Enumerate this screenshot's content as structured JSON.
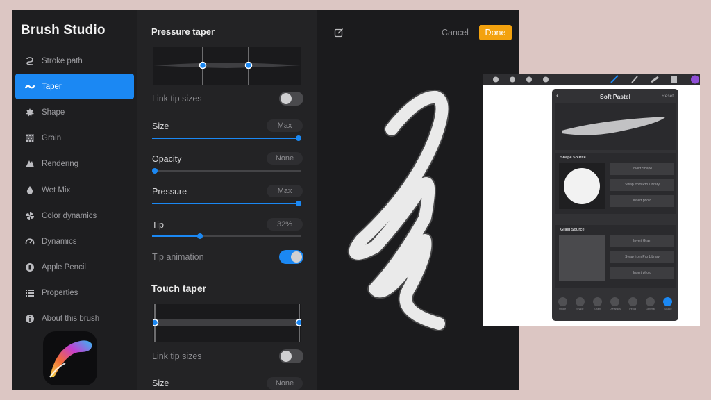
{
  "studio": {
    "title": "Brush Studio",
    "nav": [
      {
        "label": "Stroke path",
        "icon": "stroke-path-icon"
      },
      {
        "label": "Taper",
        "icon": "taper-icon",
        "active": true
      },
      {
        "label": "Shape",
        "icon": "shape-icon"
      },
      {
        "label": "Grain",
        "icon": "grain-icon"
      },
      {
        "label": "Rendering",
        "icon": "rendering-icon"
      },
      {
        "label": "Wet Mix",
        "icon": "wet-mix-icon"
      },
      {
        "label": "Color dynamics",
        "icon": "color-dynamics-icon"
      },
      {
        "label": "Dynamics",
        "icon": "dynamics-icon"
      },
      {
        "label": "Apple Pencil",
        "icon": "apple-pencil-icon"
      },
      {
        "label": "Properties",
        "icon": "properties-icon"
      },
      {
        "label": "About this brush",
        "icon": "info-icon"
      }
    ]
  },
  "pressure": {
    "title": "Pressure taper",
    "link_label": "Link tip sizes",
    "link_on": false,
    "size": {
      "label": "Size",
      "value": "Max",
      "level": 1.0
    },
    "opacity": {
      "label": "Opacity",
      "value": "None",
      "level": 0.0
    },
    "pressure": {
      "label": "Pressure",
      "value": "Max",
      "level": 1.0
    },
    "tip": {
      "label": "Tip",
      "value": "32%",
      "level": 0.32
    },
    "tip_animation_label": "Tip animation",
    "tip_animation_on": true
  },
  "touch": {
    "title": "Touch taper",
    "link_label": "Link tip sizes",
    "link_on": false,
    "size": {
      "label": "Size",
      "value": "None"
    }
  },
  "preview": {
    "cancel": "Cancel",
    "done": "Done",
    "accent": "#f3a20e"
  },
  "inset": {
    "title": "Soft Pastel",
    "reset": "Reset",
    "shape_source": {
      "label": "Shape Source",
      "buttons": [
        "Invert Shape",
        "Swap from Pro Library",
        "Insert photo"
      ]
    },
    "grain_source": {
      "label": "Grain Source",
      "buttons": [
        "Invert Grain",
        "Swap from Pro Library",
        "Insert photo"
      ]
    },
    "tabs": [
      "Stroke",
      "Shape",
      "Grain",
      "Dynamics",
      "Pencil",
      "General",
      "Source"
    ]
  },
  "colors": {
    "accent": "#1b88f3",
    "background": "#dcc6c3"
  }
}
